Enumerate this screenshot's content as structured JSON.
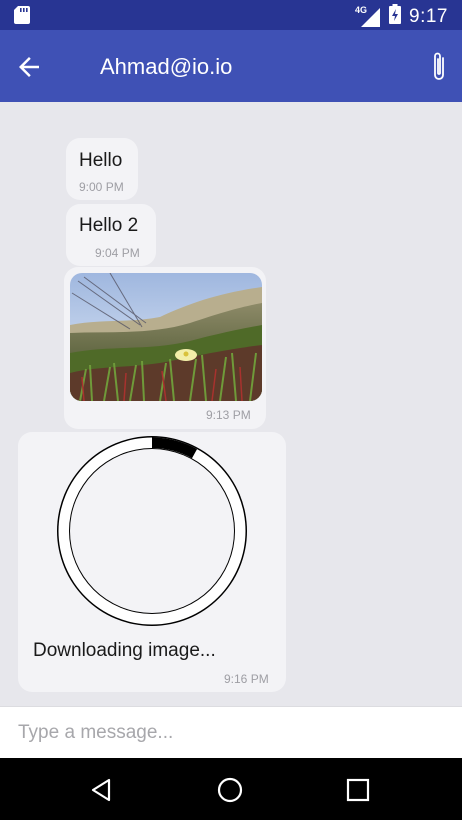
{
  "status_bar": {
    "time": "9:17",
    "network": "4G",
    "icons": [
      "sd-card-icon",
      "signal-icon",
      "battery-charging-icon"
    ]
  },
  "app_bar": {
    "title": "Ahmad@io.io",
    "back_icon": "arrow-left-icon",
    "attach_icon": "paperclip-icon",
    "color": "#3f51b5",
    "status_color": "#283593"
  },
  "messages": [
    {
      "type": "text",
      "text": "Hello",
      "time": "9:00 PM"
    },
    {
      "type": "text",
      "text": "Hello 2",
      "time": "9:04 PM"
    },
    {
      "type": "image",
      "time": "9:13 PM"
    },
    {
      "type": "download",
      "text": "Downloading image...",
      "time": "9:16 PM",
      "progress": 0.08
    }
  ],
  "composer": {
    "placeholder": "Type a message..."
  },
  "nav_bar": {
    "buttons": [
      "back-triangle-icon",
      "home-circle-icon",
      "recents-square-icon"
    ]
  }
}
